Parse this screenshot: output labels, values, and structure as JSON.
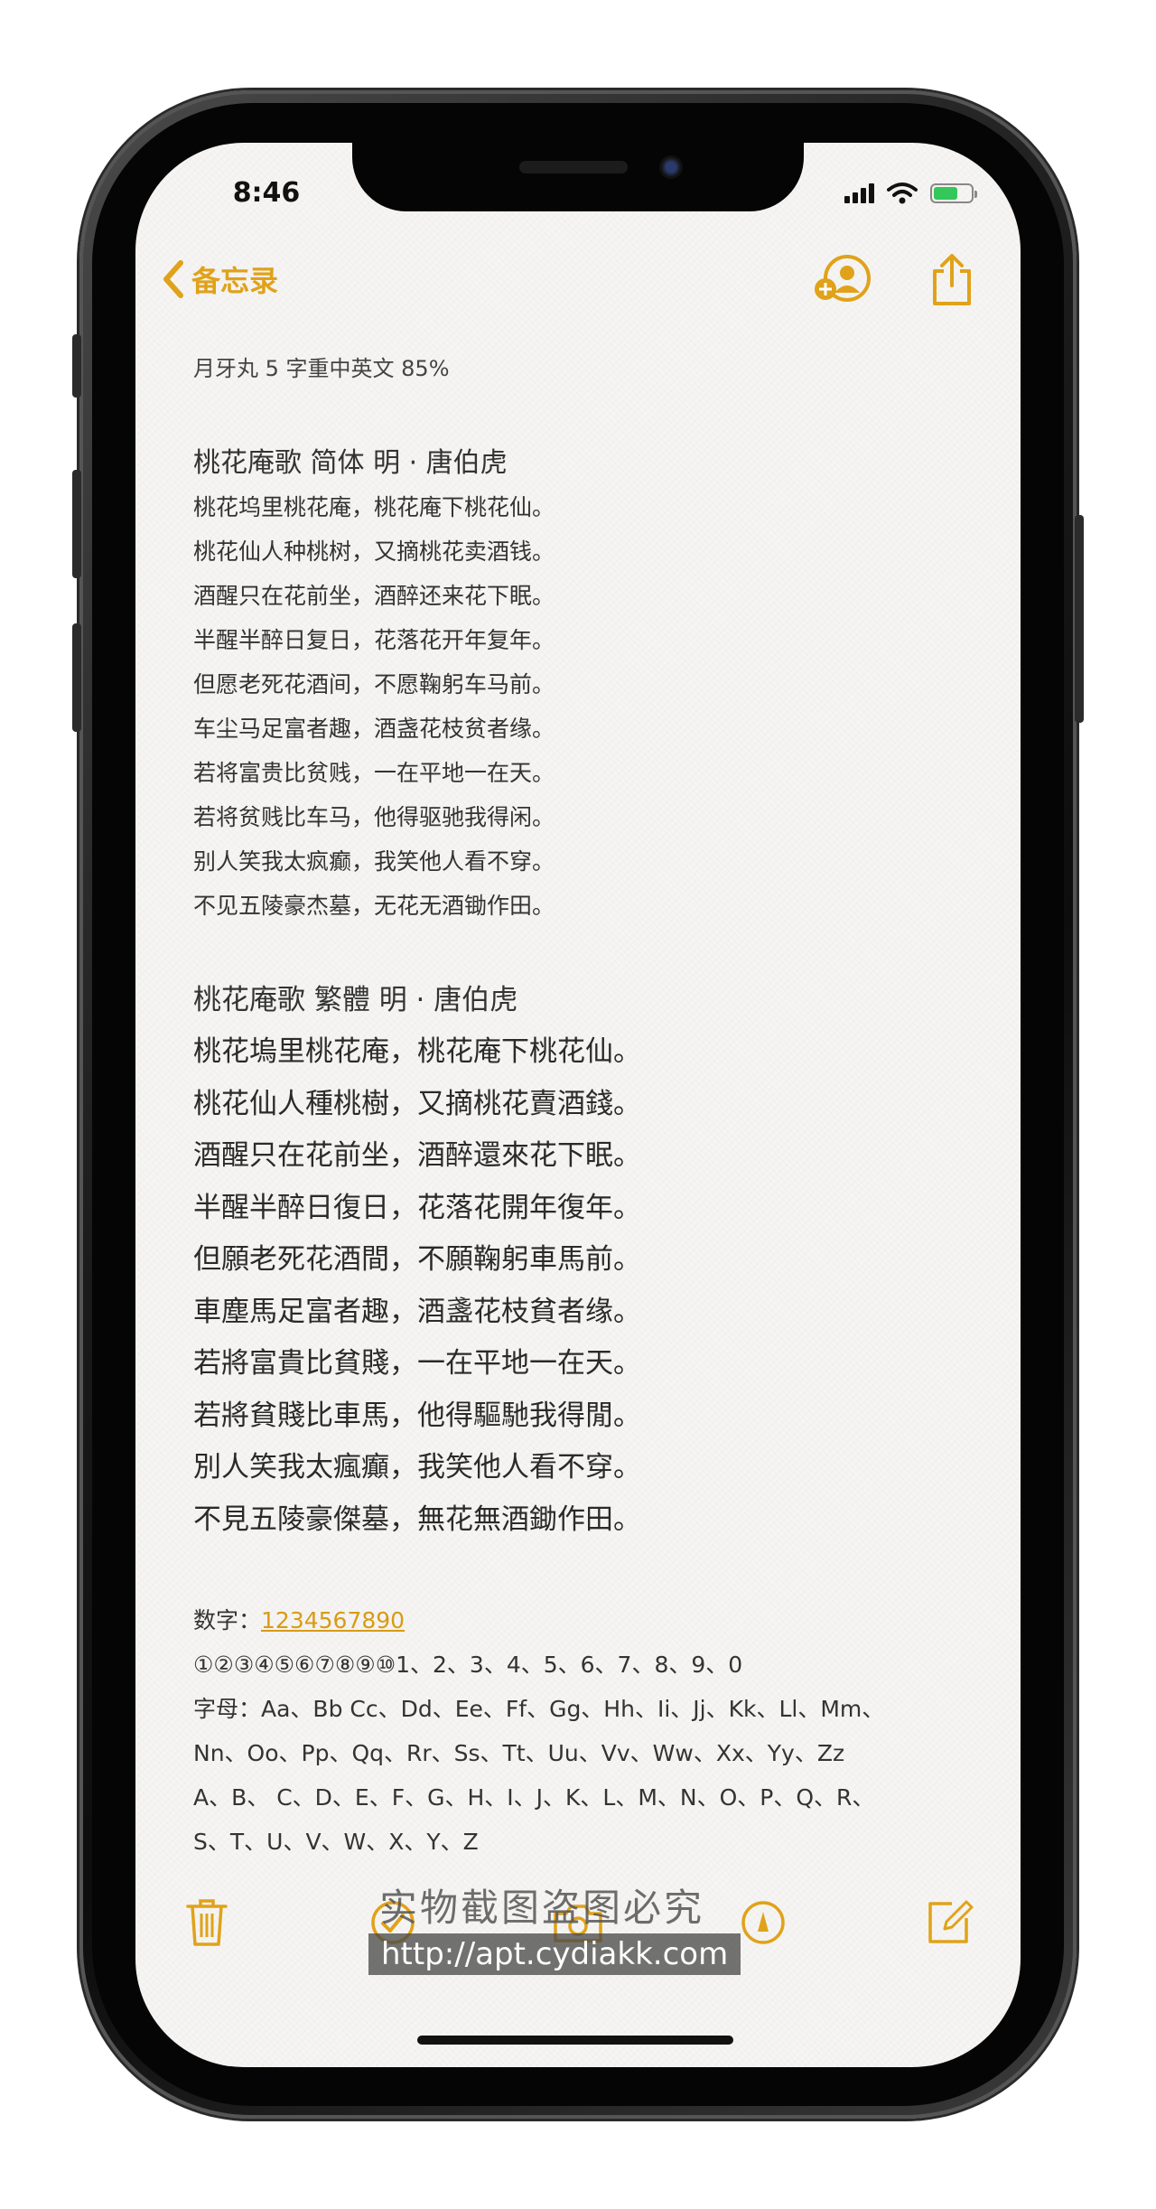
{
  "status_bar": {
    "time": "8:46"
  },
  "nav": {
    "back_label": "备忘录"
  },
  "note": {
    "header": "月牙丸 5 字重中英文 85%",
    "simplified": {
      "title": "桃花庵歌  简体   明 · 唐伯虎",
      "lines": [
        "桃花坞里桃花庵，桃花庵下桃花仙。",
        "桃花仙人种桃树，又摘桃花卖酒钱。",
        "酒醒只在花前坐，酒醉还来花下眠。",
        "半醒半醉日复日，花落花开年复年。",
        "但愿老死花酒间，不愿鞠躬车马前。",
        "车尘马足富者趣，酒盏花枝贫者缘。",
        "若将富贵比贫贱，一在平地一在天。",
        "若将贫贱比车马，他得驱驰我得闲。",
        "别人笑我太疯癫，我笑他人看不穿。",
        "不见五陵豪杰墓，无花无酒锄作田。"
      ]
    },
    "traditional": {
      "title": "桃花庵歌  繁體      明 · 唐伯虎",
      "lines": [
        "桃花塢里桃花庵，桃花庵下桃花仙。",
        "桃花仙人種桃樹，又摘桃花賣酒錢。",
        "酒醒只在花前坐，酒醉還來花下眠。",
        "半醒半醉日復日，花落花開年復年。",
        "但願老死花酒間，不願鞠躬車馬前。",
        "車塵馬足富者趣，酒盞花枝貧者缘。",
        "若將富貴比貧賤，一在平地一在天。",
        "若將貧賤比車馬，他得驅馳我得閒。",
        "別人笑我太瘋癲，我笑他人看不穿。",
        "不見五陵豪傑墓，無花無酒鋤作田。"
      ]
    },
    "numbers_label": "数字：",
    "numbers_link": "1234567890",
    "circled_line": "①②③④⑤⑥⑦⑧⑨⑩1、2、3、4、5、6、7、8、9、0",
    "letters_lines": [
      "字母：Aa、Bb Cc、Dd、Ee、Ff、Gg、Hh、Ii、Jj、Kk、Ll、Mm、",
      "Nn、Oo、Pp、Qq、Rr、Ss、Tt、Uu、Vv、Ww、Xx、Yy、Zz",
      "A、B、 C、D、E、F、G、H、I、J、K、L、M、N、O、P、Q、R、",
      "S、T、U、V、W、X、Y、Z"
    ]
  },
  "watermark": {
    "line1": "实物截图盗图必究",
    "line2": "http://apt.cydiakk.com"
  },
  "colors": {
    "accent": "#e0a21a",
    "paper": "#f6f5f3",
    "text": "#333333"
  },
  "icons": {
    "back": "chevron-left-icon",
    "add_person": "person-add-icon",
    "share": "share-icon",
    "trash": "trash-icon",
    "checklist": "checklist-icon",
    "camera": "camera-icon",
    "markup": "markup-icon",
    "compose": "compose-icon"
  }
}
